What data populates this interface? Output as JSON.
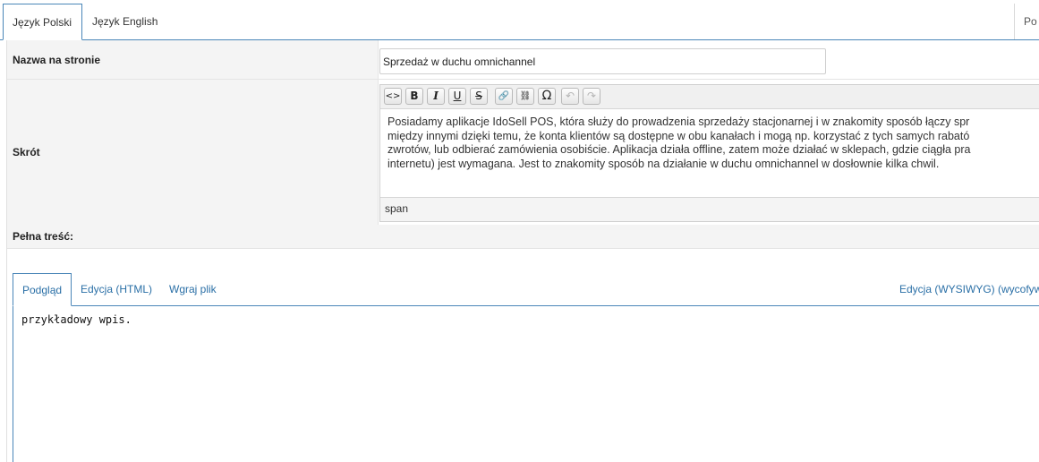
{
  "language_tabs": [
    {
      "label": "Język Polski",
      "active": true
    },
    {
      "label": "Język English",
      "active": false
    }
  ],
  "right_tab_label": "Po",
  "form": {
    "name_label": "Nazwa na stronie",
    "name_value": "Sprzedaż w duchu omnichannel",
    "short_label": "Skrót",
    "toolbar": [
      {
        "icon": "code-icon",
        "glyph": "<>"
      },
      {
        "icon": "bold-icon",
        "glyph": "B"
      },
      {
        "icon": "italic-icon",
        "glyph": "I"
      },
      {
        "icon": "underline-icon",
        "glyph": "U"
      },
      {
        "icon": "strikethrough-icon",
        "glyph": "S"
      },
      {
        "icon": "link-icon",
        "glyph": "🔗"
      },
      {
        "icon": "unlink-icon",
        "glyph": "⛓"
      },
      {
        "icon": "special-char-icon",
        "glyph": "Ω"
      },
      {
        "icon": "undo-icon",
        "glyph": "↶"
      },
      {
        "icon": "redo-icon",
        "glyph": "↷"
      }
    ],
    "short_lines": [
      "Posiadamy aplikacje IdoSell POS, która służy do prowadzenia sprzedaży stacjonarnej i w znakomity sposób łączy spr",
      "między innymi dzięki temu, że konta klientów są dostępne w obu kanałach i mogą np. korzystać z tych samych rabató",
      "zwrotów, lub odbierać zamówienia osobiście. Aplikacja działa offline, zatem może działać w sklepach, gdzie ciągła pra",
      "internetu) jest wymagana. Jest to znakomity sposób na działanie w duchu omnichannel w dosłownie kilka chwil."
    ],
    "status_path": "span",
    "full_label": "Pełna treść:"
  },
  "content_tabs": [
    {
      "label": "Podgląd",
      "active": true
    },
    {
      "label": "Edycja (HTML)",
      "active": false
    },
    {
      "label": "Wgraj plik",
      "active": false
    }
  ],
  "wysiwyg_tab_label": "Edycja (WYSIWYG) (wycofyw",
  "preview_text": "przykładowy wpis."
}
